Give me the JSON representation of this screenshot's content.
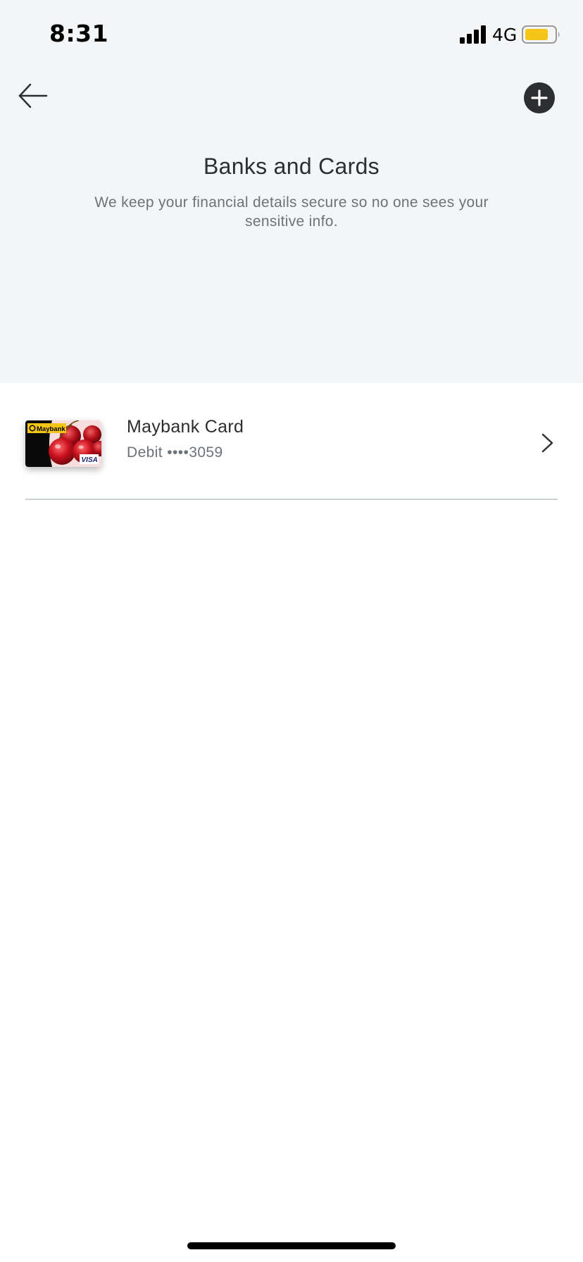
{
  "status_bar": {
    "time": "8:31",
    "network": "4G",
    "battery_color": "#f5c518"
  },
  "header": {
    "back_icon": "arrow-left-icon",
    "add_icon": "plus-circle-icon",
    "title": "Banks and Cards",
    "subtitle": "We keep your financial details secure so no one sees your sensitive info."
  },
  "cards": [
    {
      "name": "Maybank Card",
      "detail": "Debit ••••3059",
      "brand_text": "Maybank",
      "network_text": "VISA",
      "chevron_icon": "chevron-right-icon"
    }
  ],
  "colors": {
    "header_bg": "#f4f5f7",
    "title_text": "#2c2e2f",
    "secondary_text": "#6c7378",
    "divider": "#cbd2d6"
  }
}
